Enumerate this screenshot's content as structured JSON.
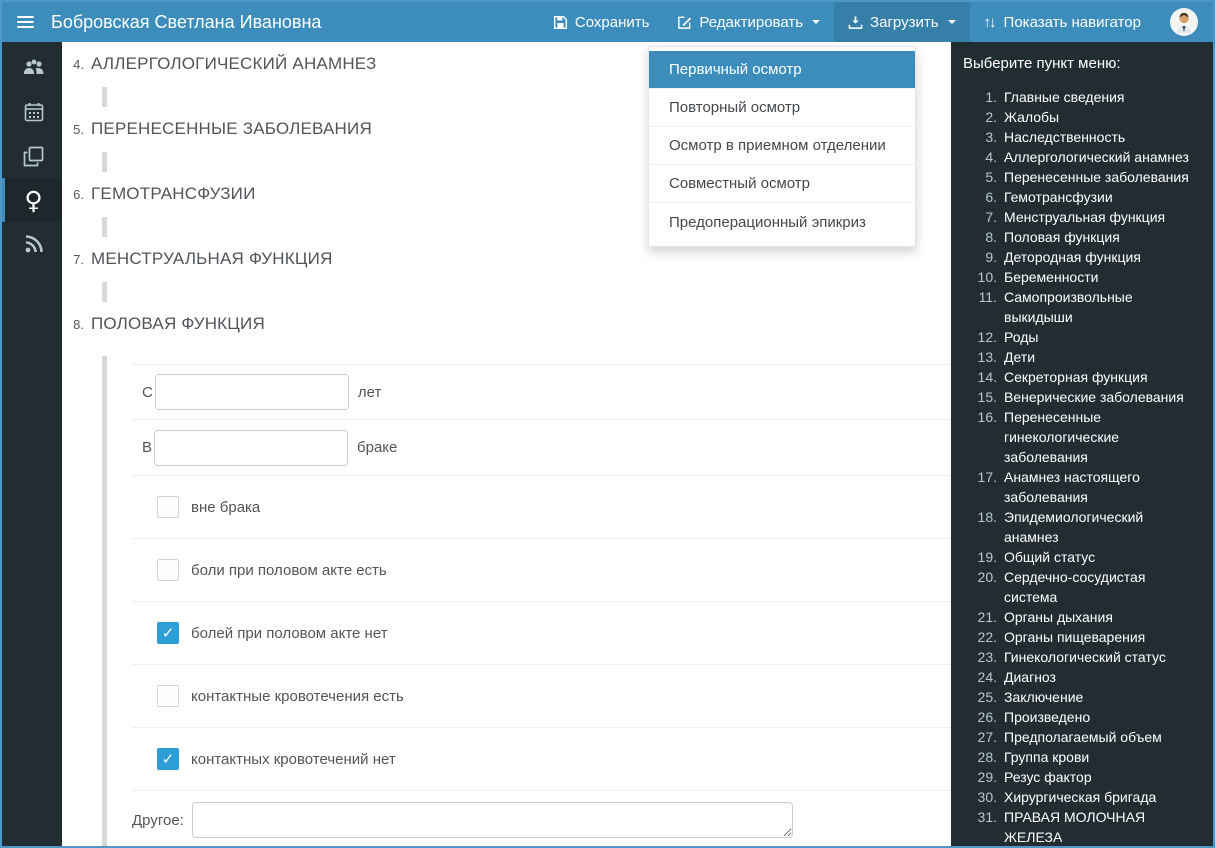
{
  "colors": {
    "navbar": "#3c8dbc",
    "navbar_active": "#367fa9",
    "panel_dark": "#222d32",
    "checkbox_checked": "#2e9fd6"
  },
  "navbar": {
    "title": "Бобровская Светлана Ивановна",
    "save_label": "Сохранить",
    "edit_label": "Редактировать",
    "upload_label": "Загрузить",
    "navigator_label": "Показать навигатор",
    "navigator_arrows": "↑↓"
  },
  "upload_menu": {
    "items": [
      {
        "label": "Первичный осмотр",
        "active": true
      },
      {
        "label": "Повторный осмотр",
        "active": false
      },
      {
        "label": "Осмотр в приемном отделении",
        "active": false
      },
      {
        "label": "Совместный осмотр",
        "active": false
      },
      {
        "label": "Предоперационный эпикриз",
        "active": false
      }
    ]
  },
  "sidebar": {
    "items": [
      {
        "icon": "users-icon",
        "active": false
      },
      {
        "icon": "calendar-icon",
        "active": false
      },
      {
        "icon": "copy-icon",
        "active": false
      },
      {
        "icon": "venus-icon",
        "active": true
      },
      {
        "icon": "rss-icon",
        "active": false
      }
    ],
    "venus_glyph": "♀"
  },
  "sections_collapsed": [
    {
      "num": "4.",
      "title": "АЛЛЕРГОЛОГИЧЕСКИЙ АНАМНЕЗ"
    },
    {
      "num": "5.",
      "title": "ПЕРЕНЕСЕННЫЕ ЗАБОЛЕВАНИЯ"
    },
    {
      "num": "6.",
      "title": "ГЕМОТРАНСФУЗИИ"
    },
    {
      "num": "7.",
      "title": "МЕНСТРУАЛЬНАЯ ФУНКЦИЯ"
    }
  ],
  "section_expanded": {
    "num": "8.",
    "title": "ПОЛОВАЯ ФУНКЦИЯ"
  },
  "form": {
    "input_rows": [
      {
        "prefix": "С",
        "value": "",
        "suffix": "лет"
      },
      {
        "prefix": "В",
        "value": "",
        "suffix": "браке"
      }
    ],
    "checkbox_rows": [
      {
        "label": "вне брака",
        "checked": false
      },
      {
        "label": "боли при половом акте есть",
        "checked": false
      },
      {
        "label": "болей при половом акте нет",
        "checked": true
      },
      {
        "label": "контактные кровотечения есть",
        "checked": false
      },
      {
        "label": "контактных кровотечений нет",
        "checked": true
      }
    ],
    "other_row": {
      "label": "Другое:",
      "value": ""
    }
  },
  "menu_panel": {
    "header": "Выберите пункт меню:",
    "items": [
      "Главные сведения",
      "Жалобы",
      "Наследственность",
      "Аллергологический анамнез",
      "Перенесенные заболевания",
      "Гемотрансфузии",
      "Менструальная функция",
      "Половая функция",
      "Детородная функция",
      "Беременности",
      "Самопроизвольные выкидыши",
      "Роды",
      "Дети",
      "Секреторная функция",
      "Венерические заболевания",
      "Перенесенные гинекологические заболевания",
      "Анамнез настоящего заболевания",
      "Эпидемиологический анамнез",
      "Общий статус",
      "Сердечно-сосудистая система",
      "Органы дыхания",
      "Органы пищеварения",
      "Гинекологический статус",
      "Диагноз",
      "Заключение",
      "Произведено",
      "Предполагаемый объем",
      "Группа крови",
      "Резус фактор",
      "Хирургическая бригада",
      "ПРАВАЯ МОЛОЧНАЯ ЖЕЛЕЗА"
    ]
  }
}
